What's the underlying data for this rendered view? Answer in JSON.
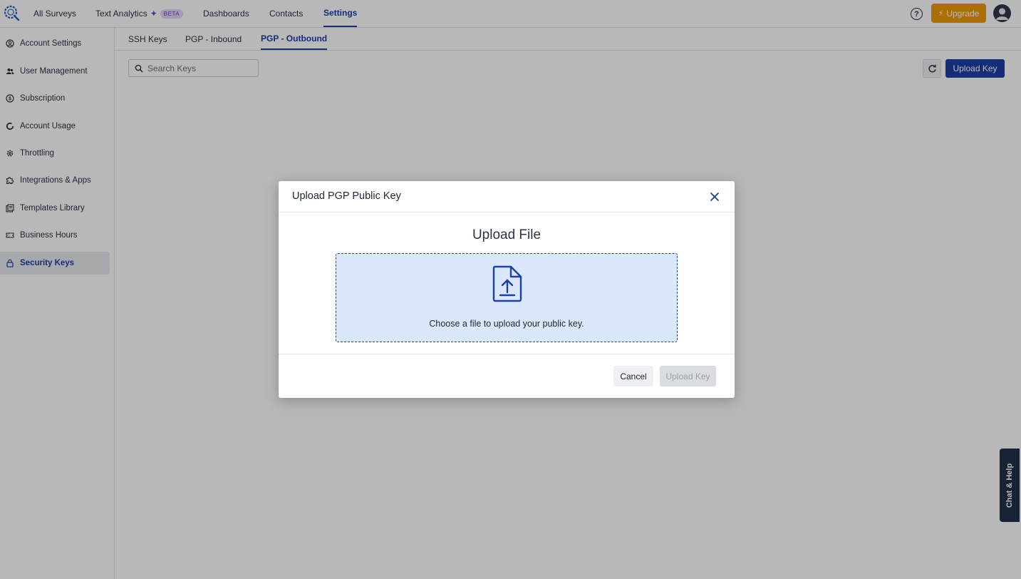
{
  "nav": {
    "items": [
      {
        "label": "All Surveys"
      },
      {
        "label": "Text Analytics",
        "badge": "BETA"
      },
      {
        "label": "Dashboards"
      },
      {
        "label": "Contacts"
      },
      {
        "label": "Settings"
      }
    ],
    "help_label": "?",
    "upgrade_label": "Upgrade"
  },
  "sidebar": {
    "items": [
      {
        "label": "Account Settings",
        "icon": "user-circle-icon"
      },
      {
        "label": "User Management",
        "icon": "users-icon"
      },
      {
        "label": "Subscription",
        "icon": "dollar-icon"
      },
      {
        "label": "Account Usage",
        "icon": "donut-icon"
      },
      {
        "label": "Throttling",
        "icon": "gear-icon"
      },
      {
        "label": "Integrations & Apps",
        "icon": "puzzle-icon"
      },
      {
        "label": "Templates Library",
        "icon": "library-icon"
      },
      {
        "label": "Business Hours",
        "icon": "ticket-icon"
      },
      {
        "label": "Security Keys",
        "icon": "lock-icon"
      }
    ],
    "active": "Security Keys"
  },
  "subtabs": [
    {
      "label": "SSH Keys"
    },
    {
      "label": "PGP - Inbound"
    },
    {
      "label": "PGP - Outbound"
    }
  ],
  "search": {
    "placeholder": "Search Keys"
  },
  "toolbar": {
    "upload_label": "Upload Key"
  },
  "chat": {
    "label": "Chat & Help"
  },
  "modal": {
    "title": "Upload PGP Public Key",
    "heading": "Upload File",
    "drop_text": "Choose a file to upload your public key.",
    "cancel_label": "Cancel",
    "upload_label": "Upload Key"
  },
  "colors": {
    "primary": "#1c3fa8",
    "upgrade": "#ef9a07",
    "dropzone_bg": "#dbe8fc"
  }
}
